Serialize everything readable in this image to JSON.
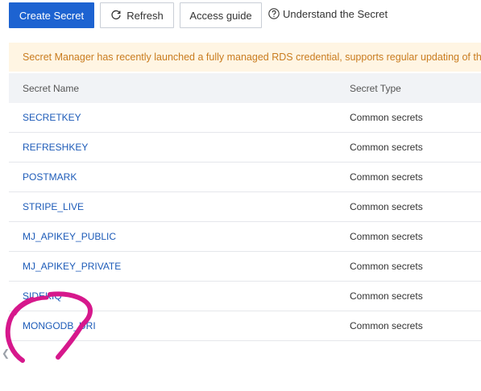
{
  "toolbar": {
    "create_label": "Create Secret",
    "refresh_label": "Refresh",
    "guide_label": "Access guide",
    "understand_label": "Understand the Secret"
  },
  "notice": {
    "text": "Secret Manager has recently launched a fully managed RDS credential, supports regular updating of the RD"
  },
  "table": {
    "headers": {
      "name": "Secret Name",
      "type": "Secret Type"
    },
    "rows": [
      {
        "name": "SECRETKEY",
        "type": "Common secrets"
      },
      {
        "name": "REFRESHKEY",
        "type": "Common secrets"
      },
      {
        "name": "POSTMARK",
        "type": "Common secrets"
      },
      {
        "name": "STRIPE_LIVE",
        "type": "Common secrets"
      },
      {
        "name": "MJ_APIKEY_PUBLIC",
        "type": "Common secrets"
      },
      {
        "name": "MJ_APIKEY_PRIVATE",
        "type": "Common secrets"
      },
      {
        "name": "SIDEKIQ",
        "type": "Common secrets"
      },
      {
        "name": "MONGODB_URI",
        "type": "Common secrets"
      }
    ]
  },
  "colors": {
    "primary": "#1d63d1",
    "link": "#1d5bb8",
    "notice_bg": "#fff5e3",
    "notice_text": "#c97c1f",
    "annotation": "#d6188c"
  },
  "icons": {
    "refresh": "refresh-icon",
    "help": "question-circle-icon",
    "scroll_left": "chevron-left-icon"
  }
}
